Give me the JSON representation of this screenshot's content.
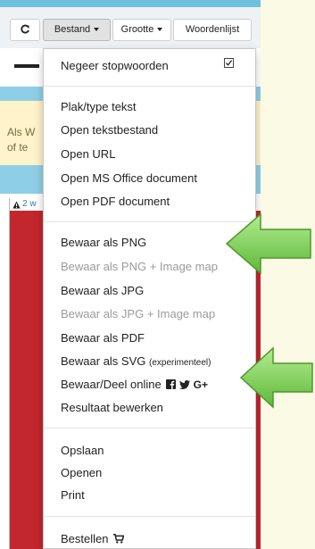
{
  "toolbar": {
    "refresh_icon": "refresh-icon",
    "bestand_label": "Bestand",
    "grootte_label": "Grootte",
    "woordenlijst_label": "Woordenlijst"
  },
  "notice": {
    "line1": "Als W",
    "line2": "of te"
  },
  "panel": {
    "warning_text": "2 w"
  },
  "menu": {
    "stopwords_label": "Negeer stopwoorden",
    "stopwords_checked": true,
    "group_input": [
      "Plak/type tekst",
      "Open tekstbestand",
      "Open URL",
      "Open MS Office document",
      "Open PDF document"
    ],
    "group_export": {
      "png": "Bewaar als PNG",
      "png_map": "Bewaar als PNG + Image map",
      "jpg": "Bewaar als JPG",
      "jpg_map": "Bewaar als JPG + Image map",
      "pdf": "Bewaar als PDF",
      "svg": "Bewaar als SVG",
      "svg_note": "(experimenteel)",
      "online": "Bewaar/Deel online",
      "online_icons": [
        "facebook-icon",
        "twitter-icon",
        "google-plus-icon"
      ],
      "edit": "Resultaat bewerken"
    },
    "group_file": [
      "Opslaan",
      "Openen",
      "Print"
    ],
    "order_label": "Bestellen",
    "order_icon": "cart-icon"
  },
  "colors": {
    "arrow_green": "#7dd35a",
    "panel_red": "#c1272d",
    "light_blue": "#8fcfe6",
    "background": "#fbfbe5"
  }
}
